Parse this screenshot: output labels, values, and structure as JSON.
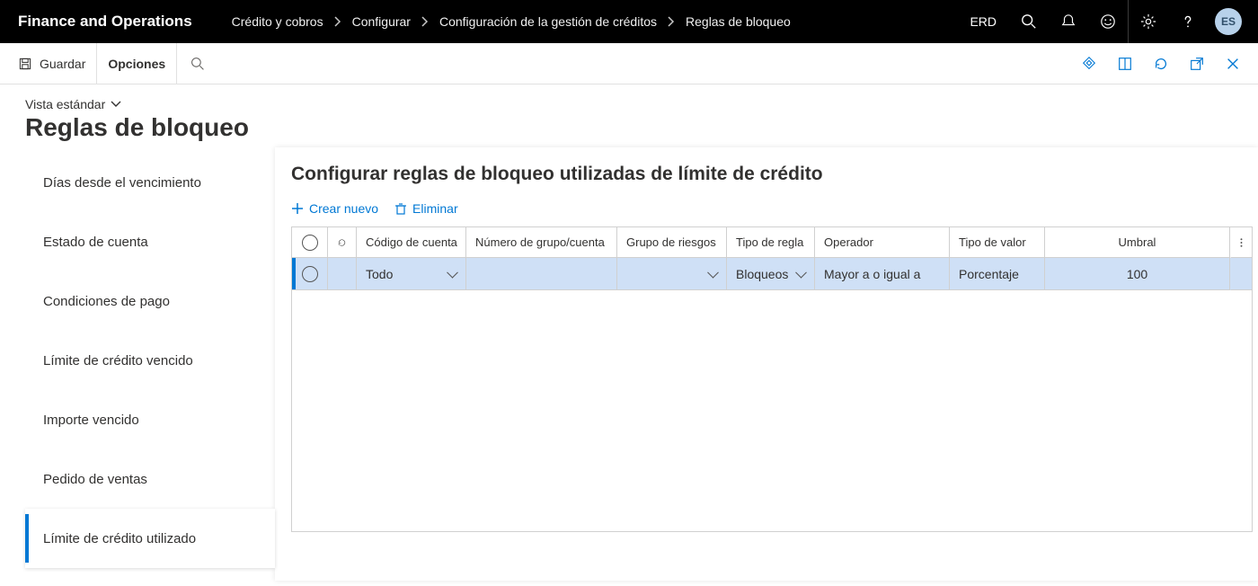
{
  "topbar": {
    "brand": "Finance and Operations",
    "breadcrumbs": [
      "Crédito y cobros",
      "Configurar",
      "Configuración de la gestión de créditos",
      "Reglas de bloqueo"
    ],
    "env": "ERD",
    "avatar": "ES"
  },
  "actionbar": {
    "save": "Guardar",
    "options": "Opciones"
  },
  "page": {
    "view": "Vista estándar",
    "title": "Reglas de bloqueo"
  },
  "leftnav": {
    "items": [
      {
        "label": "Días desde el vencimiento",
        "selected": false
      },
      {
        "label": "Estado de cuenta",
        "selected": false
      },
      {
        "label": "Condiciones de pago",
        "selected": false
      },
      {
        "label": "Límite de crédito vencido",
        "selected": false
      },
      {
        "label": "Importe vencido",
        "selected": false
      },
      {
        "label": "Pedido de ventas",
        "selected": false
      },
      {
        "label": "Límite de crédito utilizado",
        "selected": true
      }
    ]
  },
  "content": {
    "title": "Configurar reglas de bloqueo utilizadas de límite de crédito",
    "toolbar": {
      "new": "Crear nuevo",
      "delete": "Eliminar"
    },
    "columns": {
      "account_code": "Código de cuenta",
      "group_number": "Número de grupo/cuenta",
      "risk_group": "Grupo de riesgos",
      "rule_type": "Tipo de regla",
      "operator": "Operador",
      "value_type": "Tipo de valor",
      "threshold": "Umbral"
    },
    "rows": [
      {
        "account_code": "Todo",
        "group_number": "",
        "risk_group": "",
        "rule_type": "Bloqueos",
        "operator": "Mayor a o igual a",
        "value_type": "Porcentaje",
        "threshold": "100"
      }
    ]
  }
}
